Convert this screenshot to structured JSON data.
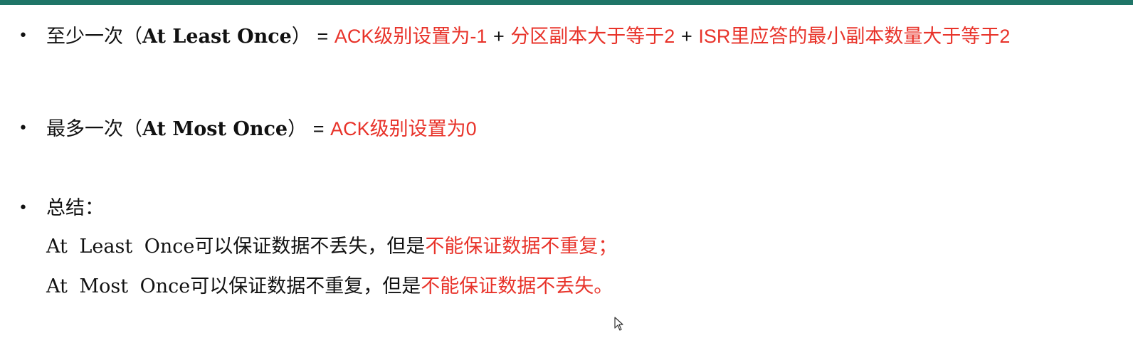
{
  "colors": {
    "accent_bar": "#1f7567",
    "highlight_text": "#e8332a",
    "body_text": "#111111"
  },
  "bullets": {
    "symbol": "•",
    "at_least_once": {
      "label_cn": "至少一次（",
      "label_en": "At Least Once",
      "label_close": "）",
      "equals": "=",
      "ack": "ACK级别设置为-1",
      "plus1": "+",
      "partition": "分区副本大于等于2",
      "plus2": "+",
      "isr": "ISR里应答的最小副本数量大于等于2"
    },
    "at_most_once": {
      "label_cn": "最多一次（",
      "label_en": "At Most Once",
      "label_close": "）",
      "equals": "=",
      "ack": "ACK级别设置为0"
    },
    "summary": {
      "title": "总结：",
      "line1_plain": "At Least Once可以保证数据不丢失，但是",
      "line1_red": "不能保证数据不重复；",
      "line2_plain": "At Most Once可以保证数据不重复，但是",
      "line2_red": "不能保证数据不丢失。"
    }
  },
  "icons": {
    "cursor": "mouse-pointer-icon"
  }
}
